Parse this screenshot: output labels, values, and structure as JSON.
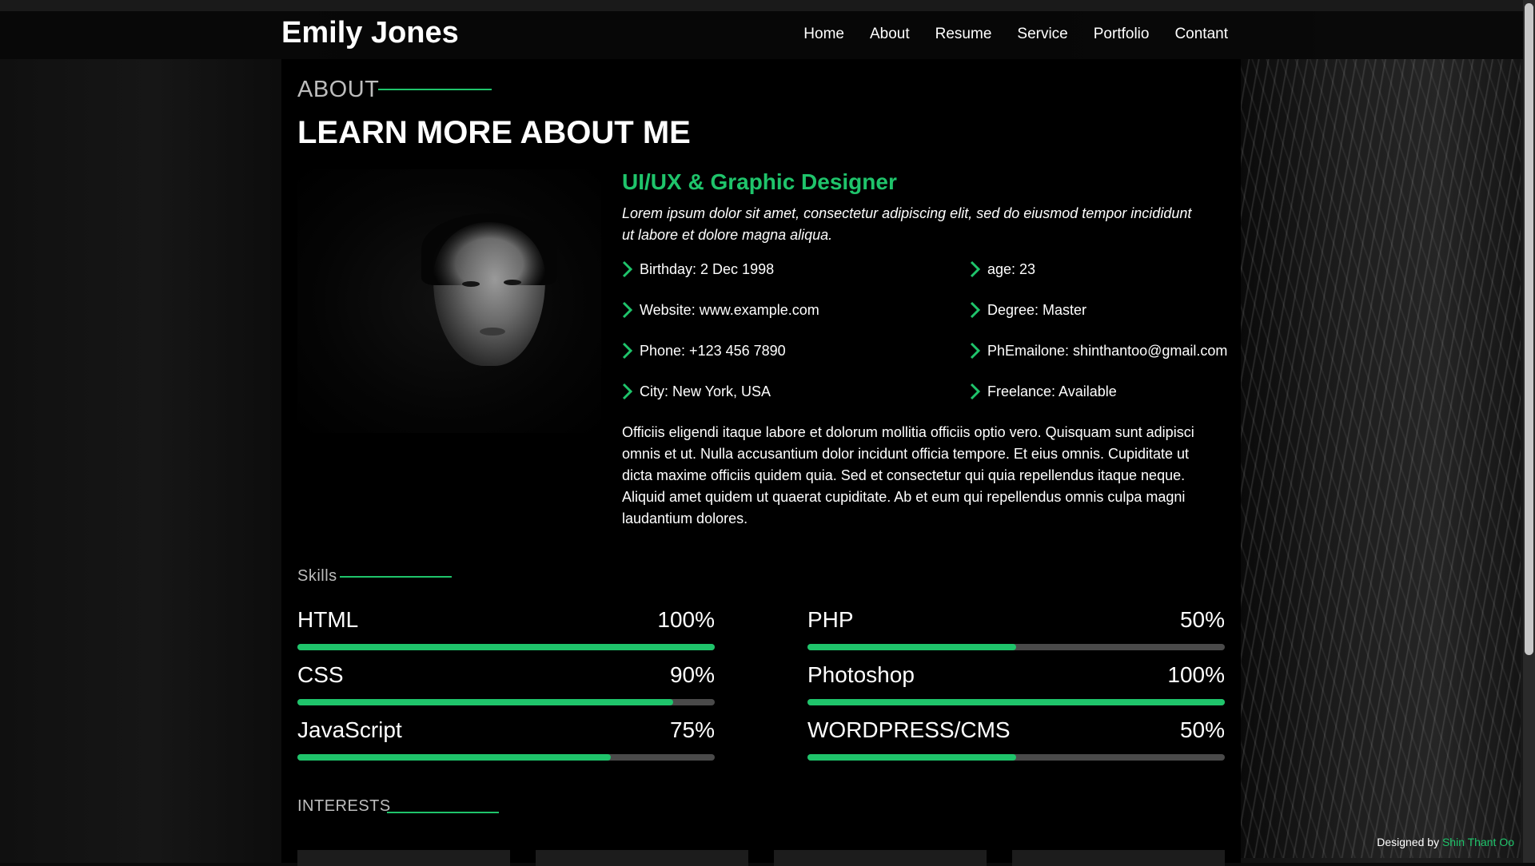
{
  "header": {
    "brand": "Emily Jones",
    "nav": [
      "Home",
      "About",
      "Resume",
      "Service",
      "Portfolio",
      "Contant"
    ]
  },
  "about": {
    "section_label": "ABOUT",
    "headline": "LEARN MORE ABOUT ME",
    "role": "UI/UX & Graphic Designer",
    "intro": "Lorem ipsum dolor sit amet, consectetur adipiscing elit, sed do eiusmod tempor incididunt ut labore et dolore magna aliqua.",
    "facts_left": [
      "Birthday: 2 Dec 1998",
      "Website: www.example.com",
      "Phone: +123 456 7890",
      "City: New York, USA"
    ],
    "facts_right": [
      "age: 23",
      "Degree: Master",
      "PhEmailone: shinthantoo@gmail.com",
      "Freelance: Available"
    ],
    "description": "Officiis eligendi itaque labore et dolorum mollitia officiis optio vero. Quisquam sunt adipisci omnis et ut. Nulla accusantium dolor incidunt officia tempore. Et eius omnis. Cupiditate ut dicta maxime officiis quidem quia. Sed et consectetur qui quia repellendus itaque neque. Aliquid amet quidem ut quaerat cupiditate. Ab et eum qui repellendus omnis culpa magni laudantium dolores."
  },
  "skills": {
    "section_label": "Skills",
    "items": [
      {
        "name": "HTML",
        "percent_label": "100%",
        "value": 100
      },
      {
        "name": "PHP",
        "percent_label": "50%",
        "value": 50
      },
      {
        "name": "CSS",
        "percent_label": "90%",
        "value": 90
      },
      {
        "name": "Photoshop",
        "percent_label": "100%",
        "value": 100
      },
      {
        "name": "JavaScript",
        "percent_label": "75%",
        "value": 75
      },
      {
        "name": "WORDPRESS/CMS",
        "percent_label": "50%",
        "value": 50
      }
    ]
  },
  "interests": {
    "section_label": "INTERESTS"
  },
  "footer": {
    "designed_by_label": "Designed by",
    "designer": "Shin Thant Oo"
  },
  "colors": {
    "accent": "#1fc46b",
    "panel": "#000000",
    "track": "#4a4a4a"
  },
  "icons": {
    "fact_bullet": "chevron-right-icon"
  }
}
